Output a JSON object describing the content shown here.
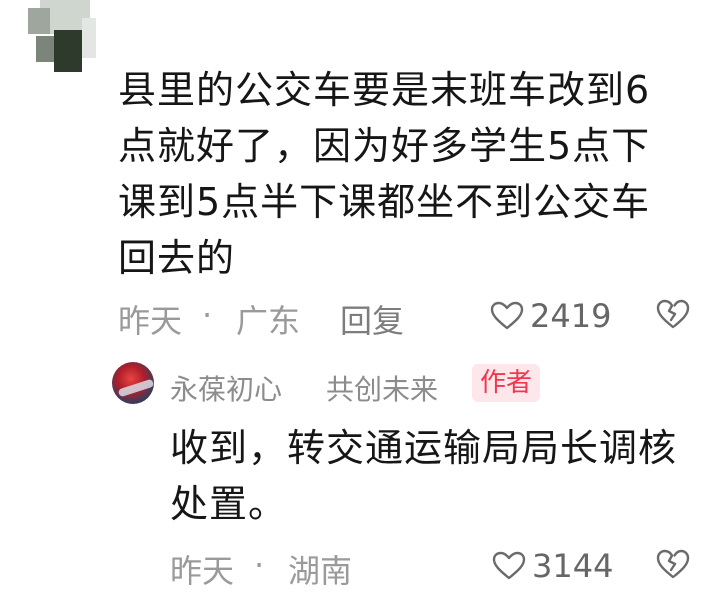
{
  "comment": {
    "text": "县里的公交车要是末班车改到6点就好了，因为好多学生5点下课到5点半下课都坐不到公交车回去的",
    "time": "昨天",
    "separator": "·",
    "location": "广东",
    "reply_label": "回复",
    "likes": "2419"
  },
  "reply": {
    "author_name": "永葆初心",
    "author_suffix": "共创未来",
    "badge": "作者",
    "text": "收到，转交通运输局局长调核处置。",
    "time": "昨天",
    "separator": "·",
    "location": "湖南",
    "likes": "3144"
  },
  "icons": {
    "like": "heart-outline-icon",
    "dislike": "broken-heart-icon"
  },
  "colors": {
    "text": "#161616",
    "meta": "#9a9a9a",
    "badge_bg": "#fde7ea",
    "badge_text": "#f2364f"
  }
}
